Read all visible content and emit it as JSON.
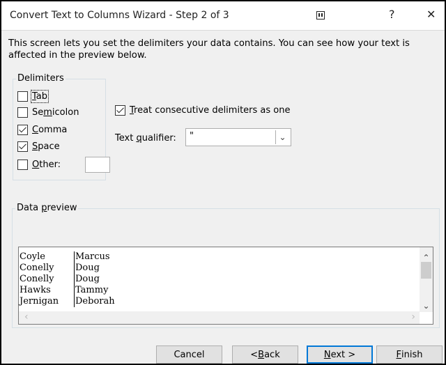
{
  "window": {
    "title": "Convert Text to Columns Wizard - Step 2 of 3",
    "help_label": "?",
    "close_label": "✕"
  },
  "description": "This screen lets you set the delimiters your data contains.  You can see how your text is affected in the preview below.",
  "delimiters": {
    "group_label": "Delimiters",
    "tab": {
      "pre": "",
      "accel": "T",
      "post": "ab",
      "checked": false
    },
    "semicolon": {
      "pre": "Se",
      "accel": "m",
      "post": "icolon",
      "checked": false
    },
    "comma": {
      "pre": "",
      "accel": "C",
      "post": "omma",
      "checked": true
    },
    "space": {
      "pre": "",
      "accel": "S",
      "post": "pace",
      "checked": true
    },
    "other": {
      "pre": "",
      "accel": "O",
      "post": "ther:",
      "checked": false,
      "value": ""
    }
  },
  "consecutive": {
    "pre": "",
    "accel": "T",
    "post": "reat consecutive delimiters as one",
    "checked": true
  },
  "qualifier": {
    "label_pre": "Text ",
    "label_accel": "q",
    "label_post": "ualifier:",
    "value": "\""
  },
  "preview": {
    "label_pre": "Data ",
    "label_accel": "p",
    "label_post": "review",
    "rows": [
      [
        "Coyle",
        "Marcus"
      ],
      [
        "Conelly",
        "Doug"
      ],
      [
        "Conelly",
        "Doug"
      ],
      [
        "Hawks",
        "Tammy"
      ],
      [
        "Jernigan",
        "Deborah"
      ]
    ]
  },
  "buttons": {
    "cancel": "Cancel",
    "back_pre": "< ",
    "back_accel": "B",
    "back_post": "ack",
    "next_accel": "N",
    "next_post": "ext >",
    "finish_accel": "F",
    "finish_post": "inish"
  },
  "colors": {
    "default_button_border": "#0078d7",
    "dialog_bg": "#f0f0f0"
  }
}
